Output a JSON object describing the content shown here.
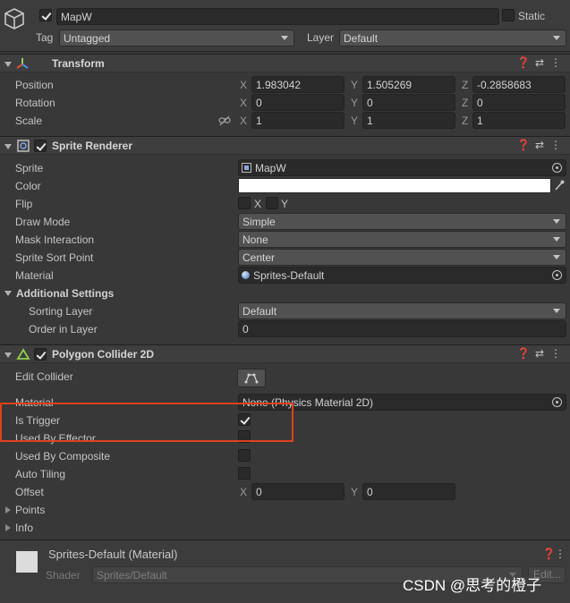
{
  "object": {
    "active_checked": true,
    "name": "MapW",
    "static_label": "Static",
    "static_checked": false,
    "tag_label": "Tag",
    "tag_value": "Untagged",
    "layer_label": "Layer",
    "layer_value": "Default"
  },
  "transform": {
    "title": "Transform",
    "position_label": "Position",
    "rotation_label": "Rotation",
    "scale_label": "Scale",
    "position": {
      "x": "1.983042",
      "y": "1.505269",
      "z": "-0.2858683"
    },
    "rotation": {
      "x": "0",
      "y": "0",
      "z": "0"
    },
    "scale": {
      "x": "1",
      "y": "1",
      "z": "1"
    },
    "axis_x": "X",
    "axis_y": "Y",
    "axis_z": "Z"
  },
  "sprite_renderer": {
    "title": "Sprite Renderer",
    "enabled": true,
    "sprite_label": "Sprite",
    "sprite_value": "MapW",
    "color_label": "Color",
    "color_value": "#ffffff",
    "flip_label": "Flip",
    "flip_x": "X",
    "flip_y": "Y",
    "draw_mode_label": "Draw Mode",
    "draw_mode_value": "Simple",
    "mask_label": "Mask Interaction",
    "mask_value": "None",
    "sort_point_label": "Sprite Sort Point",
    "sort_point_value": "Center",
    "material_label": "Material",
    "material_value": "Sprites-Default",
    "additional_label": "Additional Settings",
    "sorting_layer_label": "Sorting Layer",
    "sorting_layer_value": "Default",
    "order_label": "Order in Layer",
    "order_value": "0"
  },
  "polygon_collider": {
    "title": "Polygon Collider 2D",
    "enabled": true,
    "edit_label": "Edit Collider",
    "material_label": "Material",
    "material_value": "None (Physics Material 2D)",
    "is_trigger_label": "Is Trigger",
    "is_trigger": true,
    "effector_label": "Used By Effector",
    "composite_label": "Used By Composite",
    "auto_tiling_label": "Auto Tiling",
    "offset_label": "Offset",
    "offset": {
      "x": "0",
      "y": "0"
    },
    "points_label": "Points",
    "info_label": "Info"
  },
  "material_preview": {
    "title": "Sprites-Default (Material)",
    "shader_label": "Shader",
    "shader_value": "Sprites/Default",
    "edit_label": "Edit..."
  },
  "watermark": "CSDN @思考的橙子"
}
